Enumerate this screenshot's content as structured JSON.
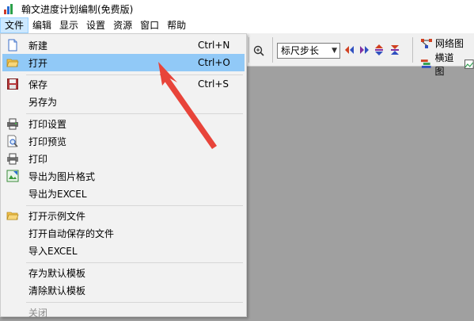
{
  "window": {
    "title": "翰文进度计划编制(免费版)"
  },
  "menubar": {
    "items": [
      "文件",
      "编辑",
      "显示",
      "设置",
      "资源",
      "窗口",
      "帮助"
    ],
    "active_index": 0
  },
  "toolbar": {
    "step_select_value": "标尺步长",
    "network_view_label": "网络图",
    "gantt_view_label": "横道图"
  },
  "file_menu": {
    "items": [
      {
        "label": "新建",
        "shortcut": "Ctrl+N",
        "icon": "new-file-icon"
      },
      {
        "label": "打开",
        "shortcut": "Ctrl+O",
        "icon": "open-folder-icon"
      },
      {
        "label": "保存",
        "shortcut": "Ctrl+S",
        "icon": "save-icon"
      },
      {
        "label": "另存为",
        "shortcut": ""
      },
      {
        "label": "打印设置",
        "shortcut": "",
        "icon": "printer-setup-icon"
      },
      {
        "label": "打印预览",
        "shortcut": "",
        "icon": "print-preview-icon"
      },
      {
        "label": "打印",
        "shortcut": "",
        "icon": "printer-icon"
      },
      {
        "label": "导出为图片格式",
        "shortcut": "",
        "icon": "export-image-icon"
      },
      {
        "label": "导出为EXCEL",
        "shortcut": ""
      },
      {
        "label": "打开示例文件",
        "shortcut": "",
        "icon": "open-folder-icon"
      },
      {
        "label": "打开自动保存的文件",
        "shortcut": ""
      },
      {
        "label": "导入EXCEL",
        "shortcut": ""
      },
      {
        "label": "存为默认模板",
        "shortcut": ""
      },
      {
        "label": "清除默认模板",
        "shortcut": ""
      },
      {
        "label": "关闭",
        "shortcut": "",
        "disabled": true
      }
    ],
    "highlighted_index": 1
  },
  "colors": {
    "highlight": "#91c9f7",
    "annotation_arrow": "#e8443a",
    "canvas": "#a0a0a0"
  }
}
